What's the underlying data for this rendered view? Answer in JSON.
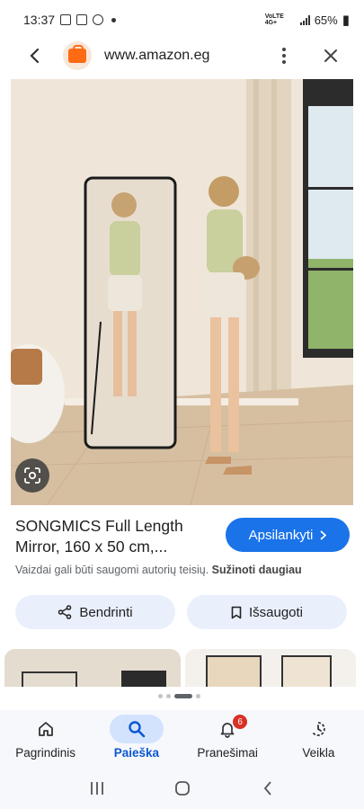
{
  "status_bar": {
    "time": "13:37",
    "network_label": "VoLTE 4G+",
    "battery": "65%"
  },
  "browser": {
    "url": "www.amazon.eg"
  },
  "result": {
    "title_line1": "SONGMICS Full Length",
    "title_line2": "Mirror, 160 x 50 cm,...",
    "visit_label": "Apsilankyti",
    "copyright_text": "Vaizdai gali būti saugomi autorių teisių.",
    "learn_more": "Sužinoti daugiau",
    "share_label": "Bendrinti",
    "save_label": "Išsaugoti"
  },
  "pager": {
    "count": 4,
    "active_index": 2
  },
  "bottom_nav": [
    {
      "label": "Pagrindinis",
      "icon": "home-icon"
    },
    {
      "label": "Paieška",
      "icon": "search-icon",
      "active": true
    },
    {
      "label": "Pranešimai",
      "icon": "bell-icon",
      "badge": "6"
    },
    {
      "label": "Veikla",
      "icon": "history-icon"
    }
  ],
  "colors": {
    "accent": "#1a73e8",
    "active_nav": "#0b57d0",
    "badge": "#d93025",
    "amazon_orange": "#ff6a14"
  }
}
